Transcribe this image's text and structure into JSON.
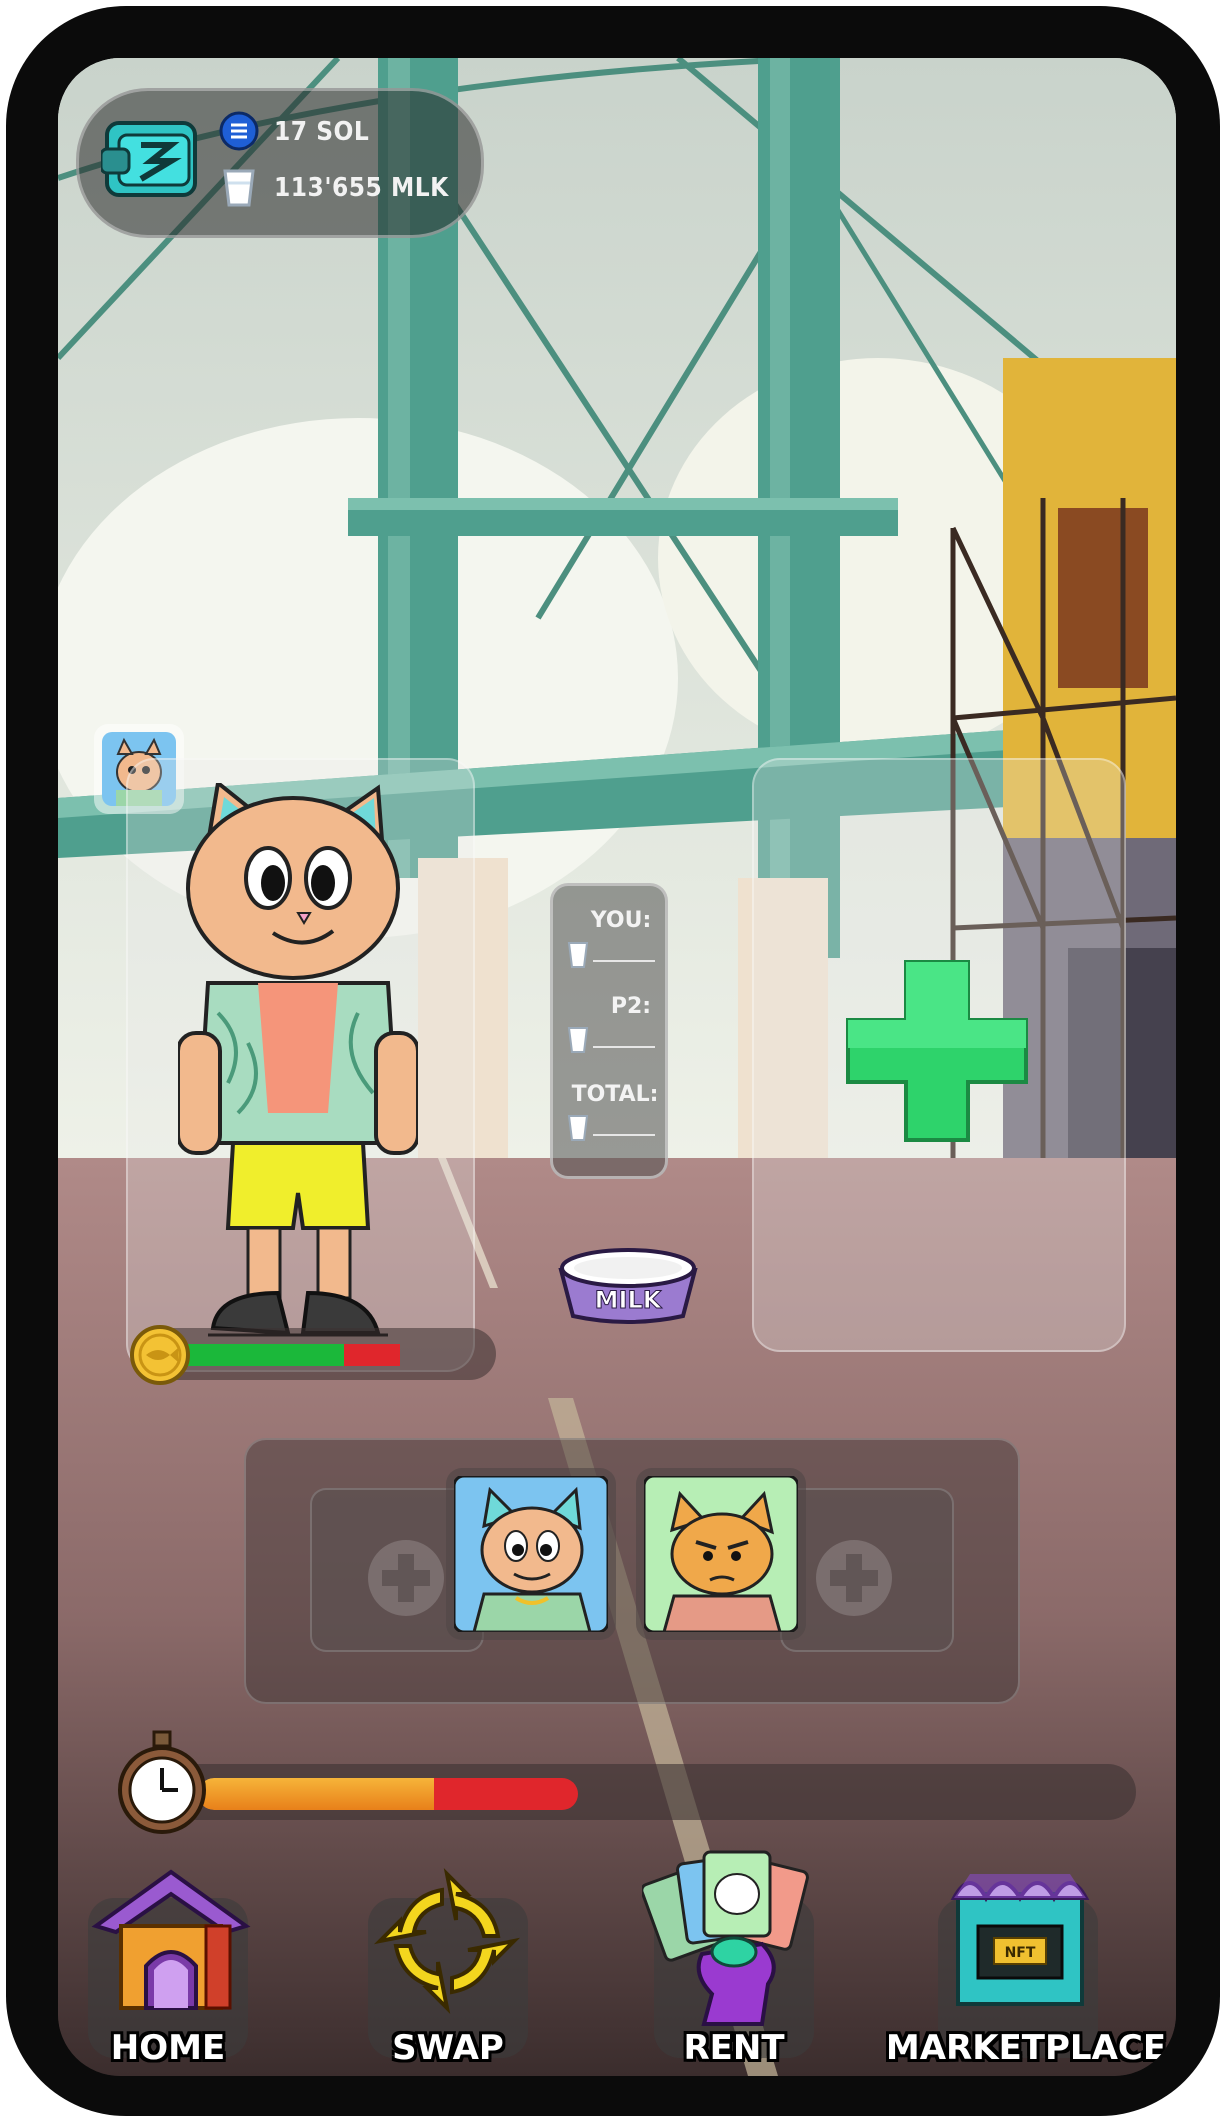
{
  "wallet": {
    "sol_balance": "17 SOL",
    "mlk_balance": "113'655 MLK",
    "wallet_icon": "wallet-icon",
    "sol_icon": "solana-coin-icon",
    "milk_icon": "milk-glass-icon"
  },
  "milk_panel": {
    "you_label": "YOU:",
    "p2_label": "P2:",
    "total_label": "TOTAL:"
  },
  "bowl": {
    "text": "MILK"
  },
  "health_bar": {
    "level": 0.6,
    "icon": "fish-coin-icon"
  },
  "timer_bar": {
    "level": 0.5,
    "icon": "stopwatch-icon"
  },
  "add_player": {
    "icon": "plus-icon"
  },
  "nav": {
    "home": "HOME",
    "swap": "SWAP",
    "rent": "RENT",
    "marketplace": "MARKETPLACE"
  },
  "colors": {
    "health_green": "#1bb83a",
    "health_red": "#e0262c",
    "timer_orange": "#f39a22",
    "timer_red": "#e0262c",
    "plus_green": "#2ed36b",
    "bridge_teal": "#4f9f8e"
  }
}
